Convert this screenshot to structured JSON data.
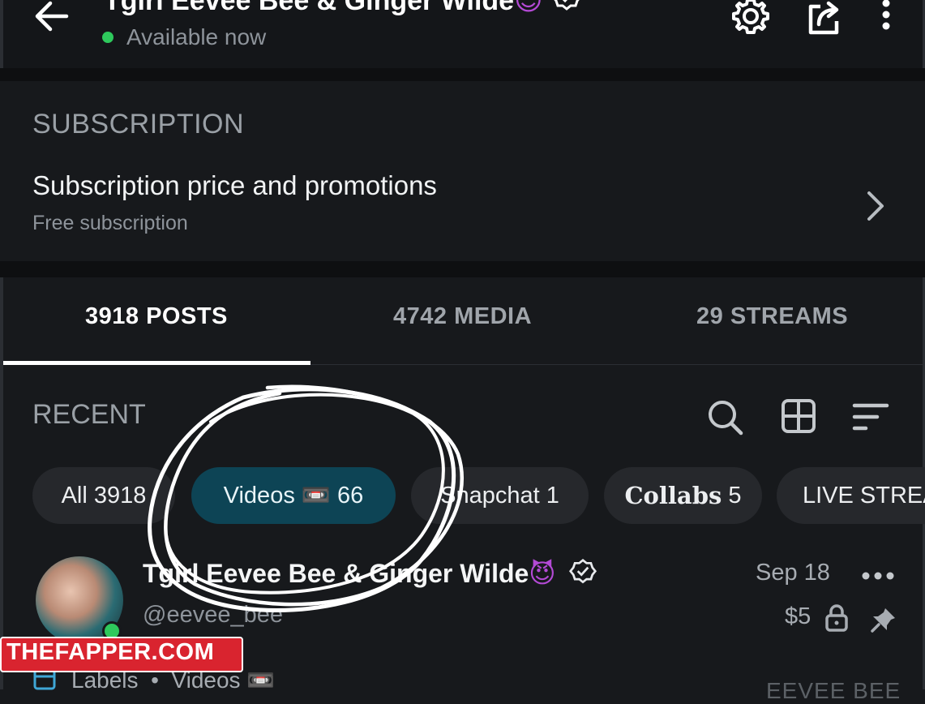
{
  "header": {
    "title": "Tgirl Eevee Bee & Ginger Wilde",
    "title_emoji": "😈",
    "status": "Available now",
    "status_color": "#2ec95c"
  },
  "subscription": {
    "heading": "SUBSCRIPTION",
    "title": "Subscription price and promotions",
    "description": "Free subscription"
  },
  "tabs": [
    {
      "label": "3918 POSTS",
      "active": true
    },
    {
      "label": "4742 MEDIA",
      "active": false
    },
    {
      "label": "29 STREAMS",
      "active": false
    }
  ],
  "recent": {
    "label": "RECENT"
  },
  "chips": [
    {
      "label": "All 3918",
      "selected": false
    },
    {
      "label": "Videos 📼 66",
      "selected": true
    },
    {
      "label": "Snapchat 1",
      "selected": false
    },
    {
      "label": "Collabs",
      "count": "5",
      "selected": false
    },
    {
      "label": "LIVE STREA",
      "selected": false
    }
  ],
  "post": {
    "name": "Tgirl Eevee Bee & Ginger Wilde",
    "name_emoji": "😈",
    "handle": "@eevee_bee",
    "date": "Sep 18",
    "price": "$5",
    "labels_label": "Labels",
    "labels_sep": "•",
    "labels_value": "Videos 📼",
    "faded_text": "EEVEE BEE"
  },
  "watermark": {
    "text": "THEFAPPER.COM"
  },
  "colors": {
    "background": "#17191c",
    "chip_selected": "#0d4455",
    "watermark": "#d9242f"
  }
}
